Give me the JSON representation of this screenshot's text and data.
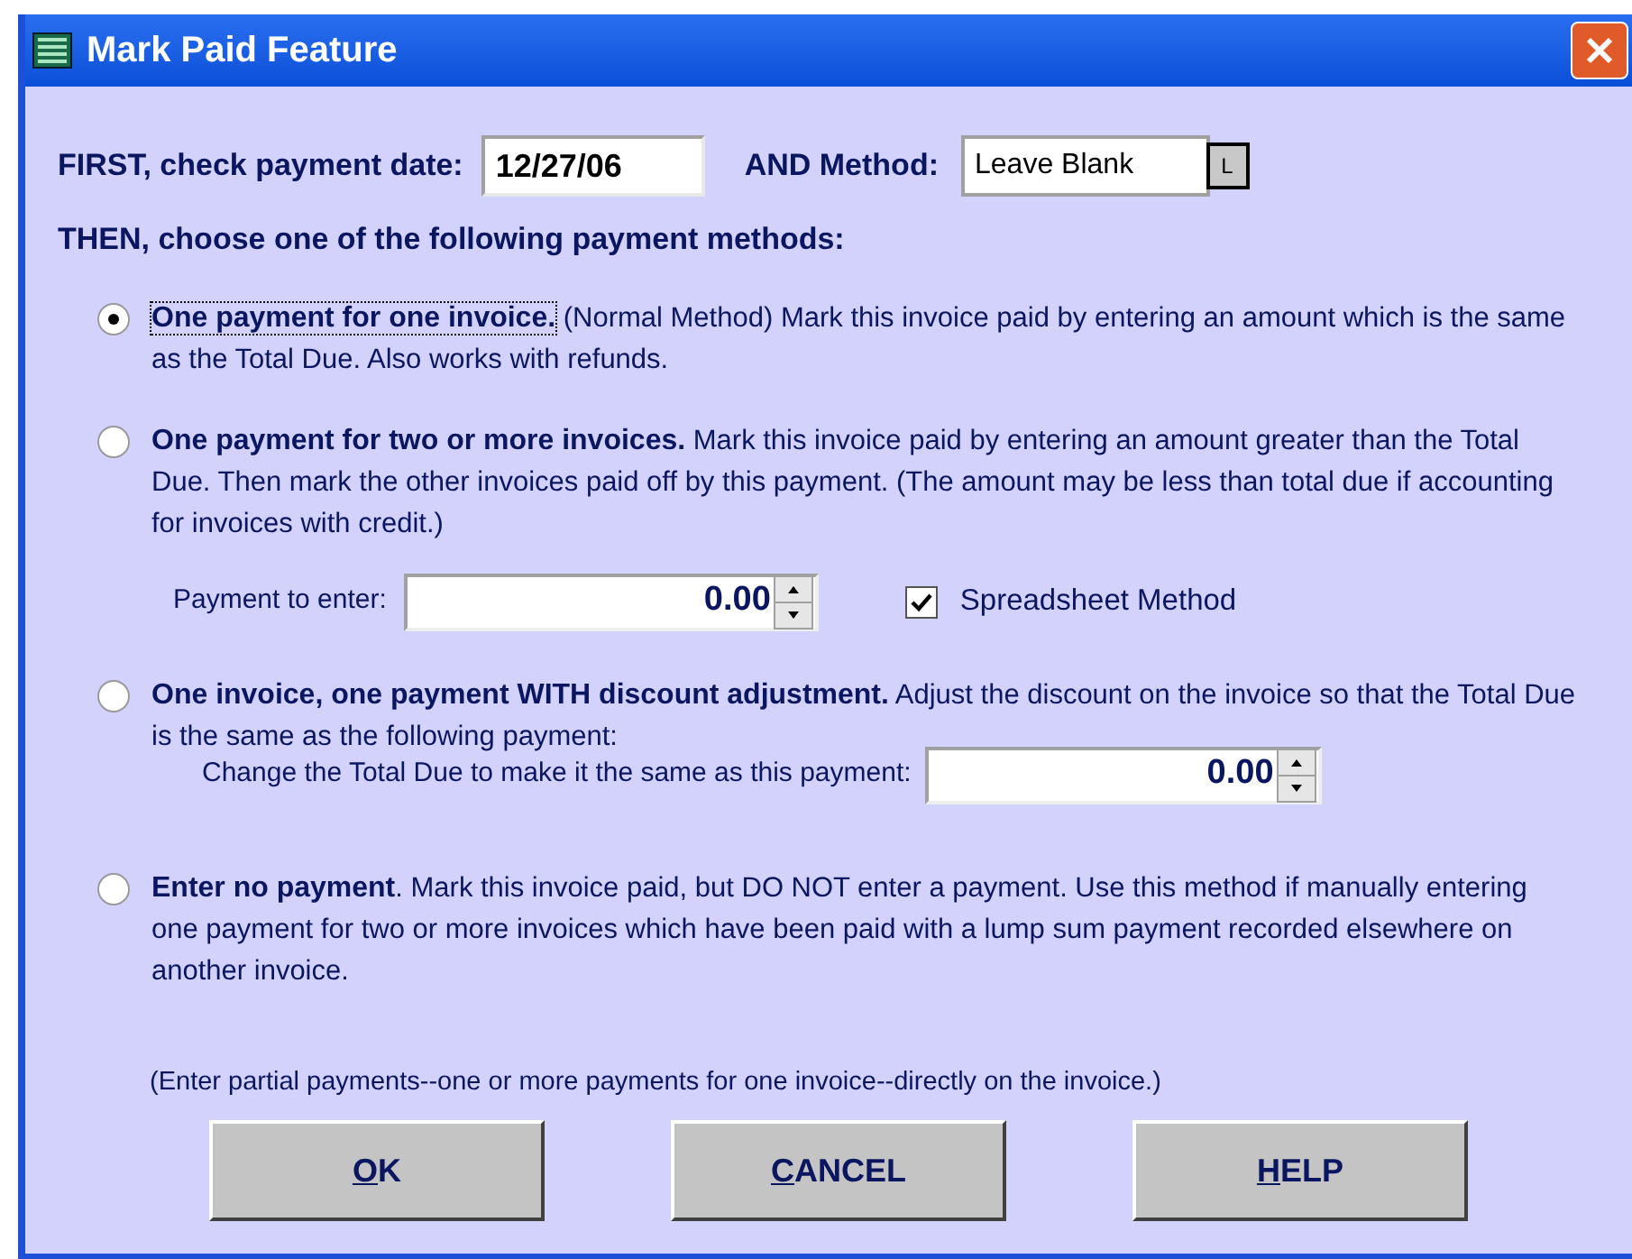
{
  "window": {
    "title": "Mark Paid Feature"
  },
  "payment_date": {
    "label": "FIRST, check payment date:",
    "value": "12/27/06"
  },
  "method": {
    "label": "AND Method:",
    "value": "Leave Blank",
    "button": "L"
  },
  "instructions": "THEN, choose one of the following payment methods:",
  "options": [
    {
      "title": "One payment for one invoice.",
      "description": " (Normal Method)  Mark this invoice paid by entering an amount which is the same as the Total Due.  Also works with refunds.",
      "selected": true,
      "focused": true
    },
    {
      "title": "One payment for two or more invoices.",
      "description": " Mark this invoice paid by entering an amount greater than the Total Due.  Then mark the other invoices paid off by this payment. (The amount may be less than total due if accounting for invoices with credit.)",
      "selected": false,
      "focused": false,
      "payment": {
        "label": "Payment to enter:",
        "value": "0.00"
      },
      "spreadsheet": {
        "label": "Spreadsheet Method",
        "checked": true
      }
    },
    {
      "title": "One invoice, one payment WITH discount adjustment.",
      "description": "  Adjust the discount on the invoice so that the Total Due is the same as the following payment:",
      "selected": false,
      "focused": false,
      "change": {
        "label": "Change the Total Due to make it the same as this payment:",
        "value": "0.00"
      }
    },
    {
      "title": "Enter no payment",
      "description": ".  Mark this invoice paid, but DO NOT enter a payment.  Use this method if manually entering one payment for two or more invoices which have been paid with a lump sum payment recorded elsewhere on another invoice.",
      "selected": false,
      "focused": false
    }
  ],
  "note": "(Enter partial payments--one or more payments for one invoice--directly on the invoice.)",
  "buttons": [
    {
      "label": "OK"
    },
    {
      "label": "CANCEL"
    },
    {
      "label": "HELP"
    }
  ]
}
